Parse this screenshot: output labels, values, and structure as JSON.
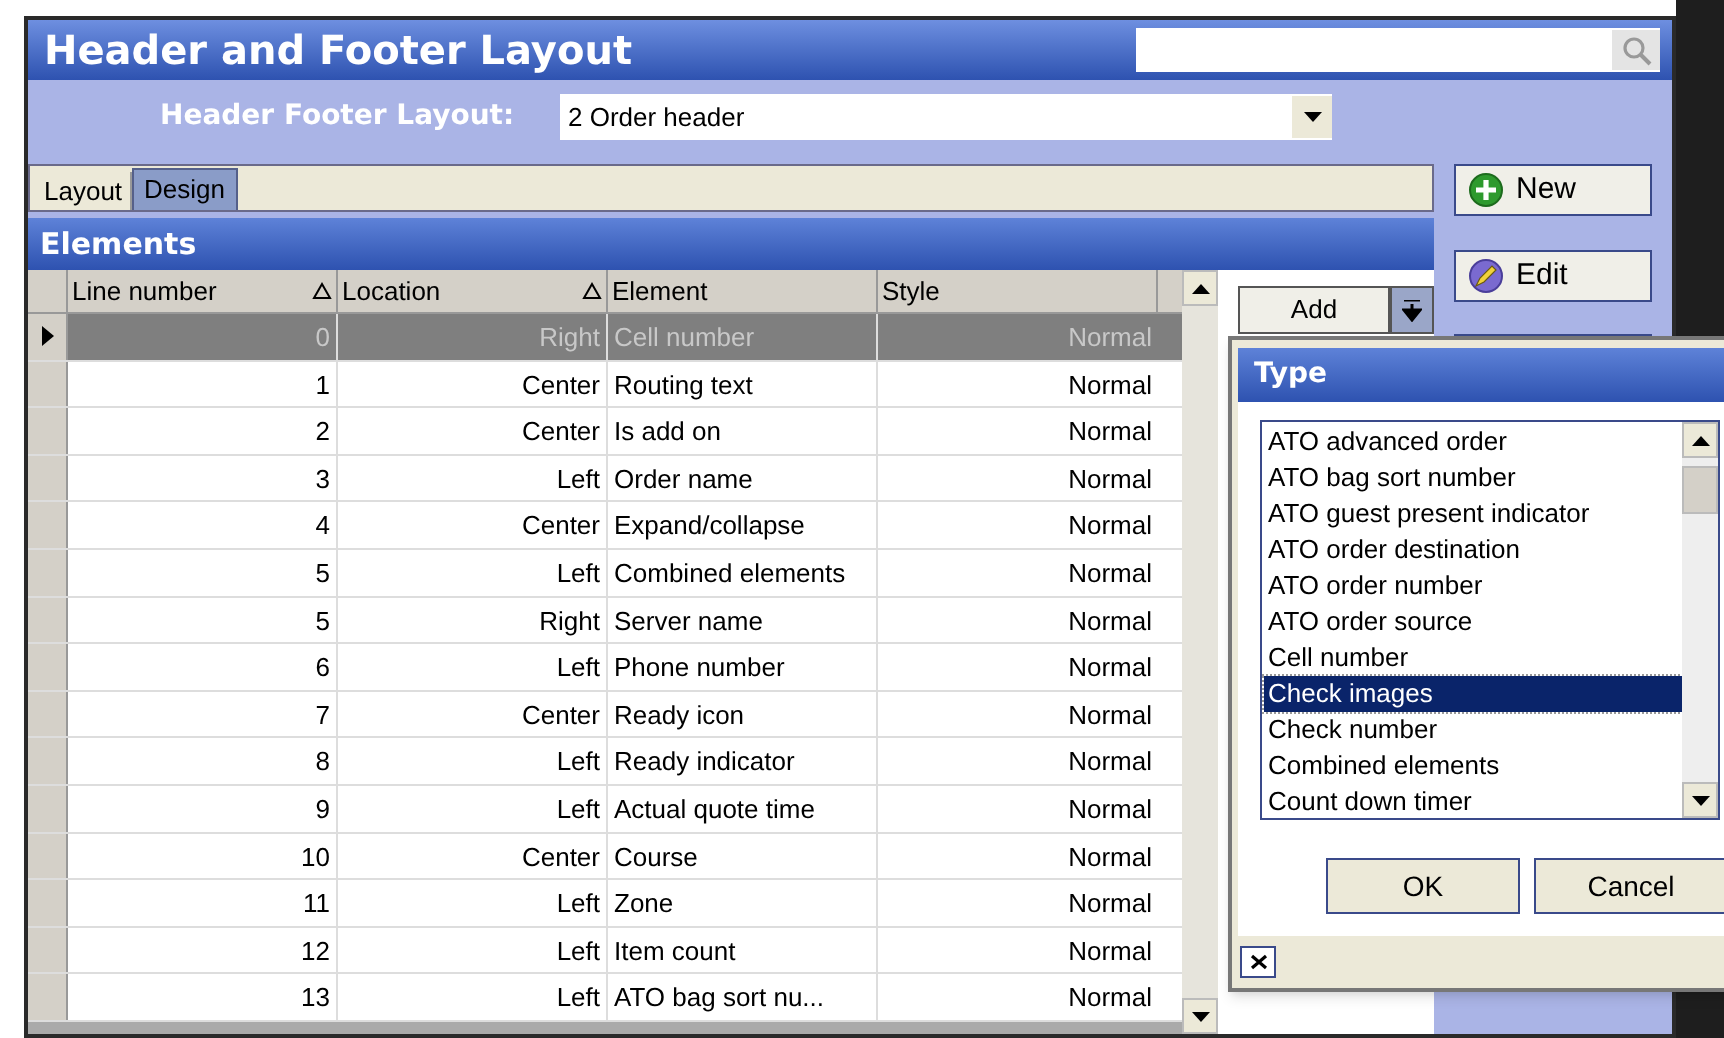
{
  "window": {
    "title": "Header and Footer Layout"
  },
  "layout_selector": {
    "label": "Header Footer Layout:",
    "value": "2 Order header"
  },
  "tabs": [
    {
      "label": "Layout",
      "selected": false
    },
    {
      "label": "Design",
      "selected": true
    }
  ],
  "elements": {
    "title": "Elements",
    "columns": [
      {
        "label": "Line number",
        "sorted": true
      },
      {
        "label": "Location",
        "sorted": true
      },
      {
        "label": "Element",
        "sorted": false
      },
      {
        "label": "Style",
        "sorted": false
      }
    ],
    "rows": [
      {
        "line": "0",
        "location": "Right",
        "element": "Cell number",
        "style": "Normal",
        "selected": true
      },
      {
        "line": "1",
        "location": "Center",
        "element": "Routing text",
        "style": "Normal",
        "selected": false
      },
      {
        "line": "2",
        "location": "Center",
        "element": "Is add on",
        "style": "Normal",
        "selected": false
      },
      {
        "line": "3",
        "location": "Left",
        "element": "Order name",
        "style": "Normal",
        "selected": false
      },
      {
        "line": "4",
        "location": "Center",
        "element": "Expand/collapse",
        "style": "Normal",
        "selected": false
      },
      {
        "line": "5",
        "location": "Left",
        "element": "Combined elements",
        "style": "Normal",
        "selected": false
      },
      {
        "line": "5",
        "location": "Right",
        "element": "Server name",
        "style": "Normal",
        "selected": false
      },
      {
        "line": "6",
        "location": "Left",
        "element": "Phone number",
        "style": "Normal",
        "selected": false
      },
      {
        "line": "7",
        "location": "Center",
        "element": "Ready icon",
        "style": "Normal",
        "selected": false
      },
      {
        "line": "8",
        "location": "Left",
        "element": "Ready indicator",
        "style": "Normal",
        "selected": false
      },
      {
        "line": "9",
        "location": "Left",
        "element": "Actual quote time",
        "style": "Normal",
        "selected": false
      },
      {
        "line": "10",
        "location": "Center",
        "element": "Course",
        "style": "Normal",
        "selected": false
      },
      {
        "line": "11",
        "location": "Left",
        "element": "Zone",
        "style": "Normal",
        "selected": false
      },
      {
        "line": "12",
        "location": "Left",
        "element": "Item count",
        "style": "Normal",
        "selected": false
      },
      {
        "line": "13",
        "location": "Left",
        "element": "ATO bag sort nu...",
        "style": "Normal",
        "selected": false
      }
    ]
  },
  "add_button": {
    "label": "Add"
  },
  "side_buttons": [
    {
      "label": "New",
      "kind": "new"
    },
    {
      "label": "Edit",
      "kind": "edit"
    }
  ],
  "type_dialog": {
    "title": "Type",
    "items": [
      {
        "label": "ATO advanced order",
        "selected": false
      },
      {
        "label": "ATO bag sort number",
        "selected": false
      },
      {
        "label": "ATO guest present indicator",
        "selected": false
      },
      {
        "label": "ATO order destination",
        "selected": false
      },
      {
        "label": "ATO order number",
        "selected": false
      },
      {
        "label": "ATO order source",
        "selected": false
      },
      {
        "label": "Cell number",
        "selected": false
      },
      {
        "label": "Check images",
        "selected": true
      },
      {
        "label": "Check number",
        "selected": false
      },
      {
        "label": "Combined elements",
        "selected": false
      },
      {
        "label": "Count down timer",
        "selected": false
      }
    ],
    "buttons": [
      "OK",
      "Cancel"
    ]
  }
}
